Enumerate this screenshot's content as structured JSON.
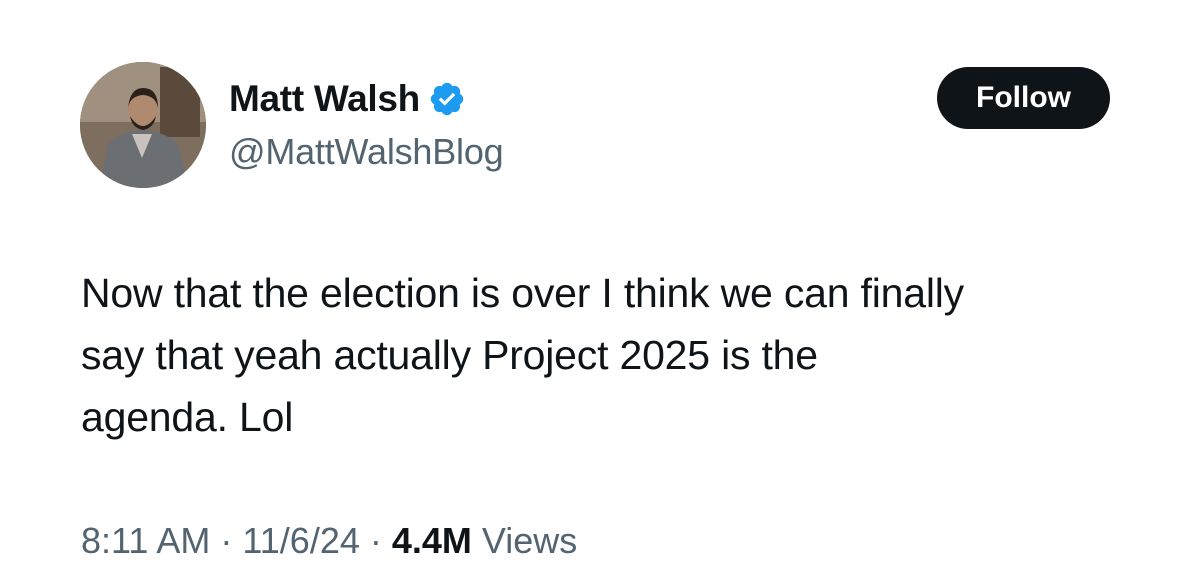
{
  "author": {
    "display_name": "Matt Walsh",
    "handle": "@MattWalshBlog",
    "verified": true,
    "verified_color": "#1d9bf0",
    "avatar_icon": "profile-photo"
  },
  "follow_button": {
    "label": "Follow",
    "background": "#0f1419",
    "text_color": "#ffffff"
  },
  "tweet": {
    "lines": [
      "Now that the election is over I think we can finally",
      "say that yeah actually Project 2025 is the",
      "agenda. Lol"
    ]
  },
  "meta": {
    "time": "8:11 AM",
    "separator": "·",
    "date": "11/6/24",
    "views_count": "4.4M",
    "views_label": "Views"
  }
}
